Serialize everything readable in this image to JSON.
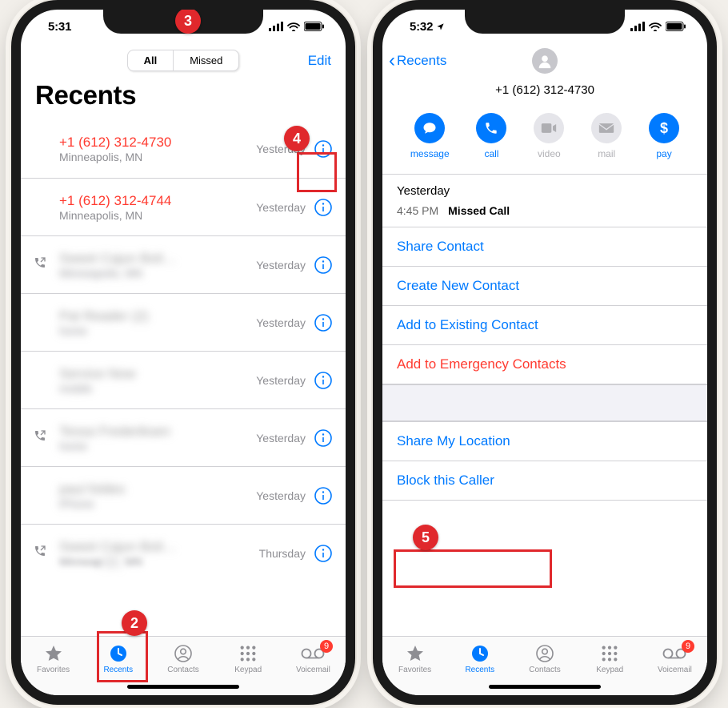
{
  "left": {
    "time": "5:31",
    "location_arrow": false,
    "segmented": {
      "all": "All",
      "missed": "Missed"
    },
    "edit": "Edit",
    "title": "Recents",
    "calls": [
      {
        "number": "+1 (612) 312-4730",
        "sub": "Minneapolis, MN",
        "time": "Yesterday",
        "missed": true,
        "outgoing": false,
        "blur": false
      },
      {
        "number": "+1 (612) 312-4744",
        "sub": "Minneapolis, MN",
        "time": "Yesterday",
        "missed": true,
        "outgoing": false,
        "blur": false
      },
      {
        "number": "Sweet Cajun Boil…",
        "sub": "Minneapolis, MN",
        "time": "Yesterday",
        "missed": false,
        "outgoing": true,
        "blur": true
      },
      {
        "number": "Pat Reader (2)",
        "sub": "home",
        "time": "Yesterday",
        "missed": false,
        "outgoing": false,
        "blur": true
      },
      {
        "number": "Service Now",
        "sub": "mobile",
        "time": "Yesterday",
        "missed": false,
        "outgoing": false,
        "blur": true
      },
      {
        "number": "Tessa Frederiksen",
        "sub": "home",
        "time": "Yesterday",
        "missed": false,
        "outgoing": true,
        "blur": true
      },
      {
        "number": "paul foldes",
        "sub": "iPhone",
        "time": "Yesterday",
        "missed": false,
        "outgoing": false,
        "blur": true
      },
      {
        "number": "Sweet Cajun Boil…",
        "sub": "Minneapolis, MN",
        "time": "Thursday",
        "missed": false,
        "outgoing": true,
        "blur": true,
        "semiBlurSub": "Minneap"
      }
    ],
    "tabs": {
      "favorites": "Favorites",
      "recents": "Recents",
      "contacts": "Contacts",
      "keypad": "Keypad",
      "voicemail": "Voicemail",
      "voicemail_badge": "9"
    }
  },
  "right": {
    "time": "5:32",
    "location_arrow": true,
    "back": "Recents",
    "phone": "+1 (612) 312-4730",
    "actions": {
      "message": "message",
      "call": "call",
      "video": "video",
      "mail": "mail",
      "pay": "pay"
    },
    "log": {
      "day": "Yesterday",
      "time": "4:45 PM",
      "kind": "Missed Call"
    },
    "links": {
      "share": "Share Contact",
      "create": "Create New Contact",
      "add_existing": "Add to Existing Contact",
      "add_emergency": "Add to Emergency Contacts",
      "share_location": "Share My Location",
      "block": "Block this Caller"
    },
    "tabs": {
      "favorites": "Favorites",
      "recents": "Recents",
      "contacts": "Contacts",
      "keypad": "Keypad",
      "voicemail": "Voicemail",
      "voicemail_badge": "9"
    }
  },
  "callouts": {
    "b2": "2",
    "b3": "3",
    "b4": "4",
    "b5": "5"
  }
}
